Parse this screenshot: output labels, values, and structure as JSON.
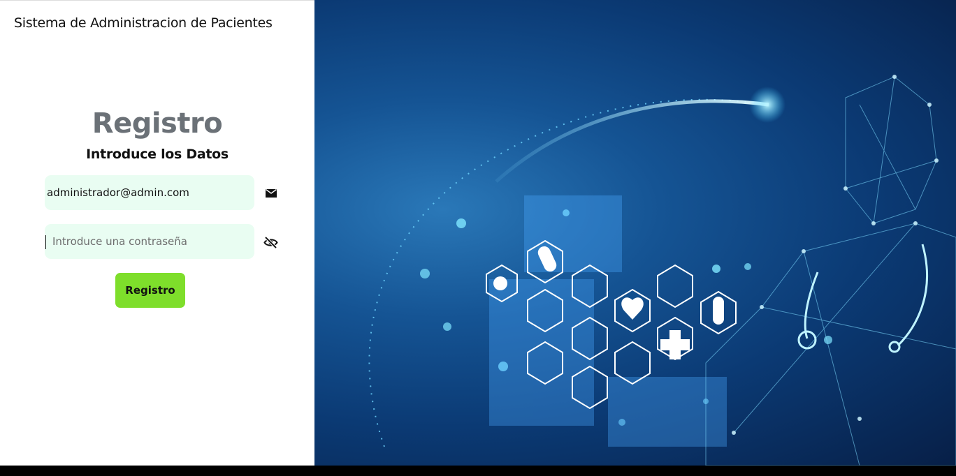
{
  "app": {
    "title": "Sistema de Administracion de Pacientes"
  },
  "form": {
    "title": "Registro",
    "subtitle": "Introduce los Datos",
    "email_value": "administrador@admin.com",
    "password_placeholder": "Introduce una contraseña",
    "submit_label": "Registro"
  },
  "icons": {
    "email": "envelope-icon",
    "password_toggle": "eye-slash-icon"
  },
  "colors": {
    "field_background": "#e9fdf2",
    "button_background": "#7ede2b",
    "title_color": "#6b7177",
    "hero_background": "#0b3a74"
  }
}
